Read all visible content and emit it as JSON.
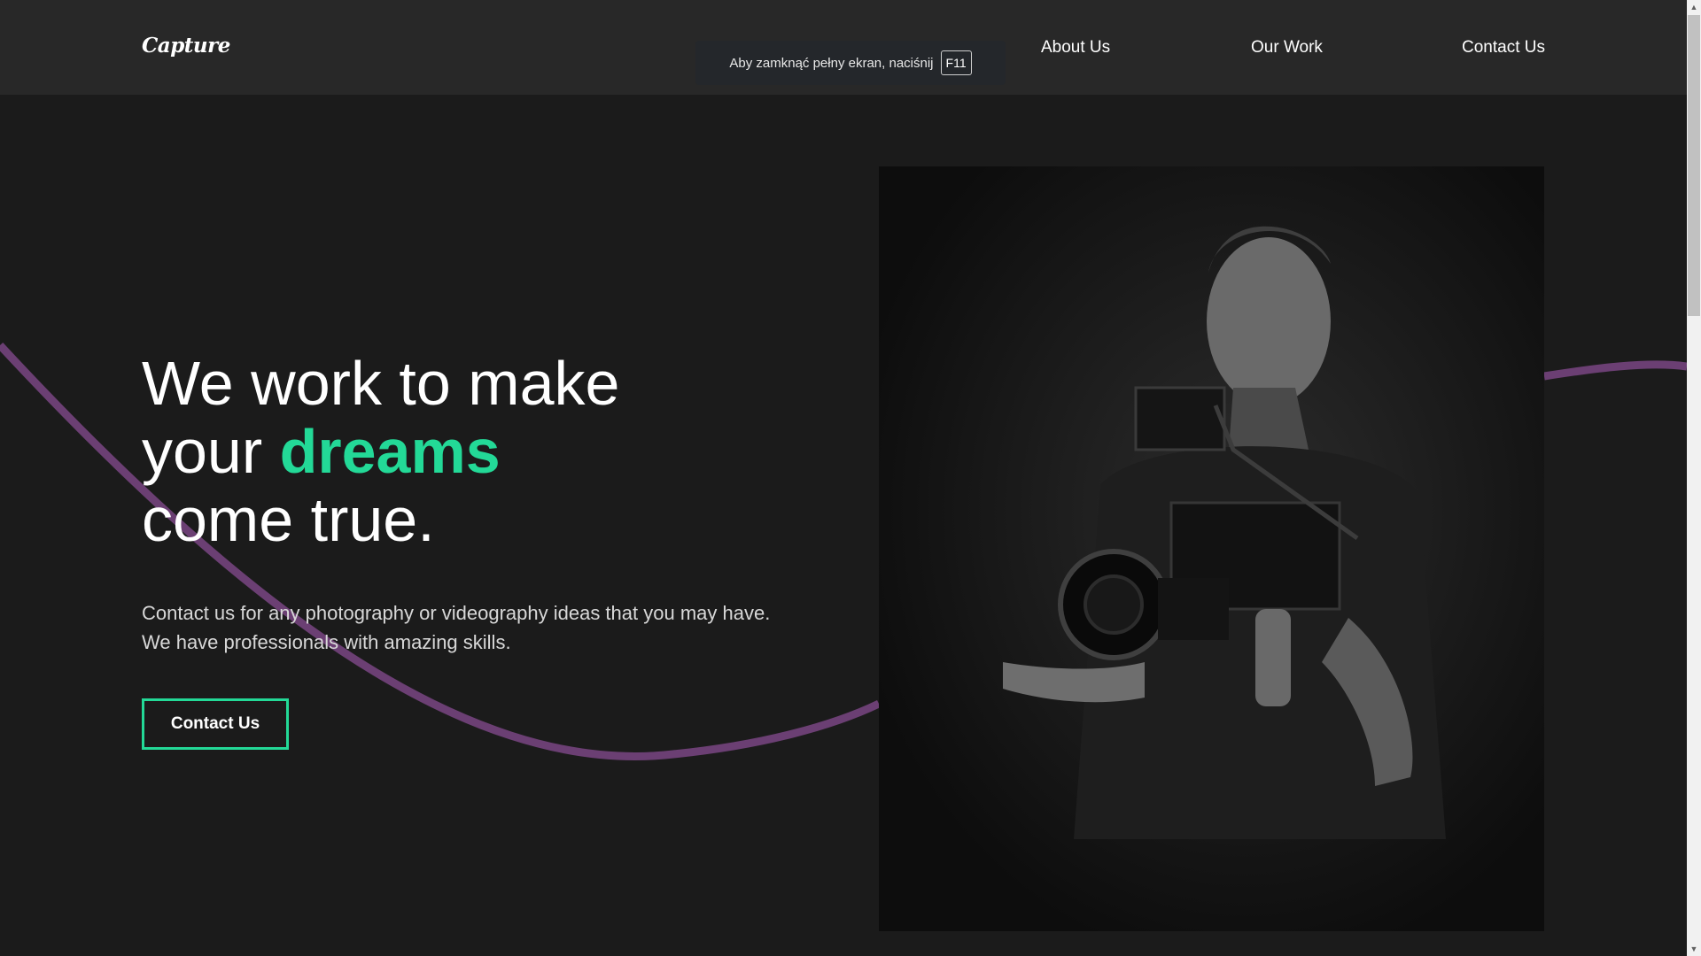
{
  "header": {
    "logo": "Capture",
    "nav": [
      "About Us",
      "Our Work",
      "Contact Us"
    ]
  },
  "fullscreen_notice": {
    "text": "Aby zamknąć pełny ekran, naciśnij",
    "key": "F11"
  },
  "hero": {
    "title_line1": "We work to make",
    "title_line2_prefix": "your ",
    "title_accent": "dreams",
    "title_line3": "come true.",
    "description": "Contact us for any photography or videography ideas that you may have. We have professionals with amazing skills.",
    "cta_label": "Contact Us",
    "image_alt": "Videographer holding a camera rig"
  },
  "colors": {
    "background": "#1b1b1b",
    "nav_background": "#282828",
    "accent": "#23d997",
    "curve": "#6b3f73"
  }
}
